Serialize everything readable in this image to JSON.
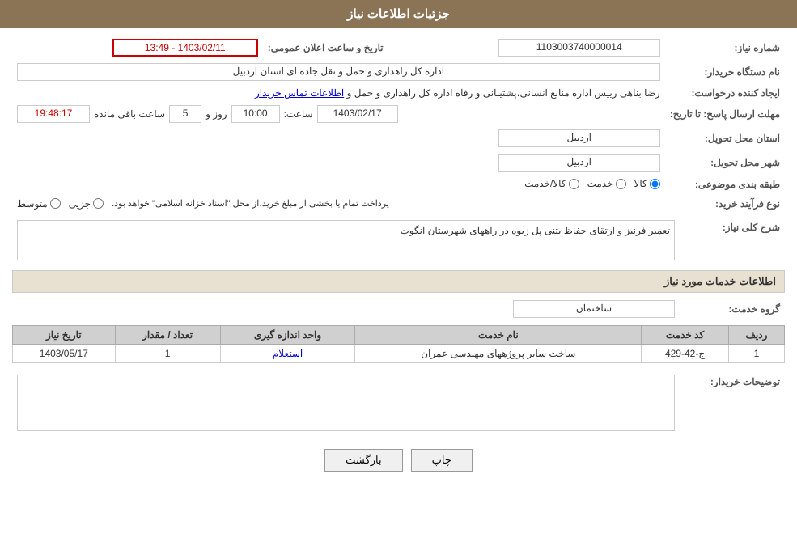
{
  "header": {
    "title": "جزئیات اطلاعات نیاز"
  },
  "fields": {
    "need_number_label": "شماره نیاز:",
    "need_number_value": "1103003740000014",
    "announce_date_label": "تاریخ و ساعت اعلان عمومی:",
    "announce_date_value": "1403/02/11 - 13:49",
    "org_name_label": "نام دستگاه خریدار:",
    "org_name_value": "اداره کل راهداری و حمل و نقل جاده ای استان اردبیل",
    "creator_label": "ایجاد کننده درخواست:",
    "creator_value": "رضا بناهی رییس اداره منابع انسانی،پشتیبانی و رفاه اداره کل راهداری و حمل و",
    "creator_link": "اطلاعات تماس خریدار",
    "deadline_label": "مهلت ارسال پاسخ: تا تاریخ:",
    "deadline_date": "1403/02/17",
    "deadline_time_label": "ساعت:",
    "deadline_time": "10:00",
    "deadline_days_label": "روز و",
    "deadline_days": "5",
    "deadline_remaining_label": "ساعت باقی مانده",
    "deadline_remaining": "19:48:17",
    "province_label": "استان محل تحویل:",
    "province_value": "اردبیل",
    "city_label": "شهر محل تحویل:",
    "city_value": "اردبیل",
    "category_label": "طبقه بندی موضوعی:",
    "category_options": [
      "کالا",
      "خدمت",
      "کالا/خدمت"
    ],
    "category_selected": "کالا",
    "process_label": "نوع فرآیند خرید:",
    "process_options": [
      "جزیی",
      "متوسط"
    ],
    "process_note": "پرداخت تمام یا بخشی از مبلغ خرید،از محل \"اسناد خزانه اسلامی\" خواهد بود.",
    "need_desc_label": "شرح کلی نیاز:",
    "need_desc_value": "تعمیر فرنیز و ارتقای حفاظ بتنی پل زیوه در راههای شهرستان انگوت",
    "services_section_label": "اطلاعات خدمات مورد نیاز",
    "service_group_label": "گروه خدمت:",
    "service_group_value": "ساختمان",
    "services_table": {
      "headers": [
        "ردیف",
        "کد خدمت",
        "نام خدمت",
        "واحد اندازه گیری",
        "تعداد / مقدار",
        "تاریخ نیاز"
      ],
      "rows": [
        {
          "row": "1",
          "code": "ج-42-429",
          "name": "ساخت سایر پروژههای مهندسی عمران",
          "unit": "استعلام",
          "quantity": "1",
          "date": "1403/05/17"
        }
      ]
    },
    "buyer_notes_label": "توضیحات خریدار:",
    "buyer_notes_value": ""
  },
  "buttons": {
    "back_label": "بازگشت",
    "print_label": "چاپ"
  }
}
